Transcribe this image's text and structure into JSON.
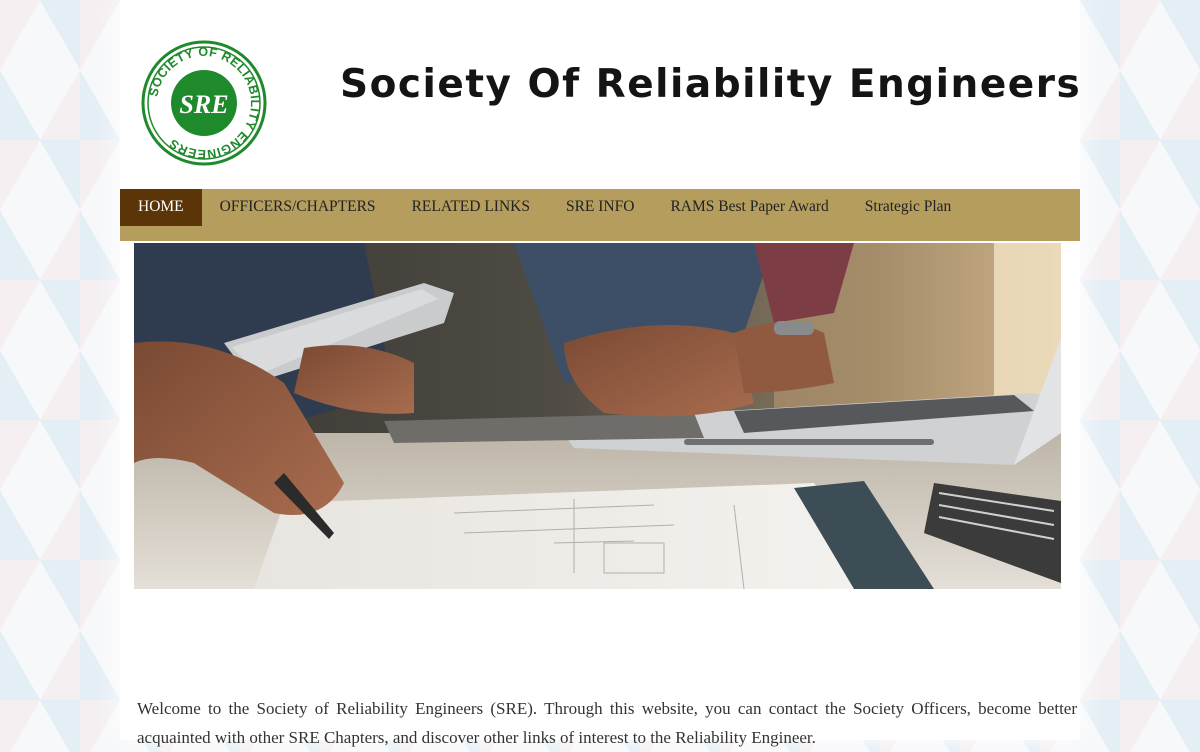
{
  "header": {
    "title": "Society Of Reliability Engineers",
    "logo": {
      "ring_text": "SOCIETY OF RELIABILITY ENGINEERS",
      "monogram": "SRE",
      "color": "#1f8a2c"
    }
  },
  "nav": {
    "items": [
      {
        "label": "HOME",
        "active": true
      },
      {
        "label": "OFFICERS/CHAPTERS",
        "active": false
      },
      {
        "label": "RELATED LINKS",
        "active": false
      },
      {
        "label": "SRE INFO",
        "active": false
      },
      {
        "label": "RAMS Best Paper Award",
        "active": false
      },
      {
        "label": "Strategic Plan",
        "active": false
      }
    ],
    "bar_color": "#b59d5d",
    "active_color": "#5b3508"
  },
  "intro": {
    "text": "Welcome to the Society of Reliability Engineers (SRE). Through this website, you can contact the Society Officers, become better acquainted with other SRE Chapters, and discover other links of interest to the Reliability Engineer."
  }
}
